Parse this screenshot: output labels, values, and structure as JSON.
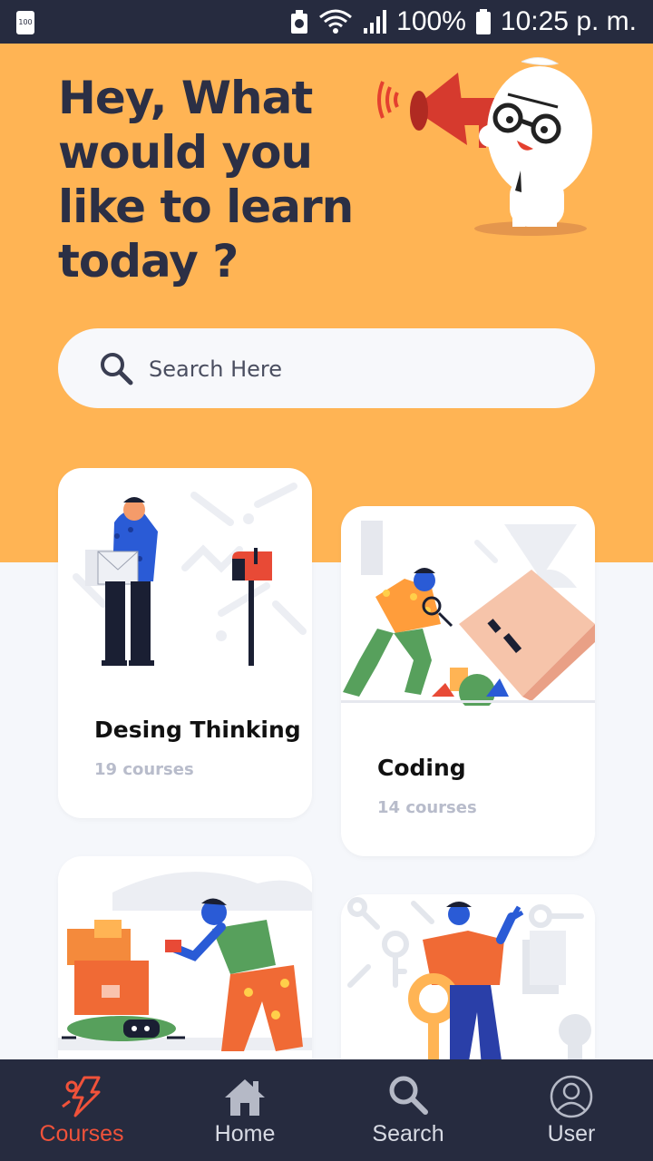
{
  "status_bar": {
    "small_battery_text": "100",
    "battery": "100%",
    "time": "10:25 p. m."
  },
  "header": {
    "headline": "Hey, What would you like to learn today ?"
  },
  "search": {
    "placeholder": "Search Here"
  },
  "categories": [
    {
      "title": "Desing Thinking",
      "count": "19 courses"
    },
    {
      "title": "Coding",
      "count": "14 courses"
    },
    {
      "title": "",
      "count": ""
    },
    {
      "title": "",
      "count": ""
    }
  ],
  "nav": [
    {
      "label": "Courses",
      "icon": "courses-icon",
      "active": true
    },
    {
      "label": "Home",
      "icon": "home-icon",
      "active": false
    },
    {
      "label": "Search",
      "icon": "search-icon",
      "active": false
    },
    {
      "label": "User",
      "icon": "user-icon",
      "active": false
    }
  ],
  "colors": {
    "header_bg": "#ffb454",
    "nav_bg": "#262b3f",
    "active_nav": "#f0523a",
    "headline": "#2b2f45"
  }
}
